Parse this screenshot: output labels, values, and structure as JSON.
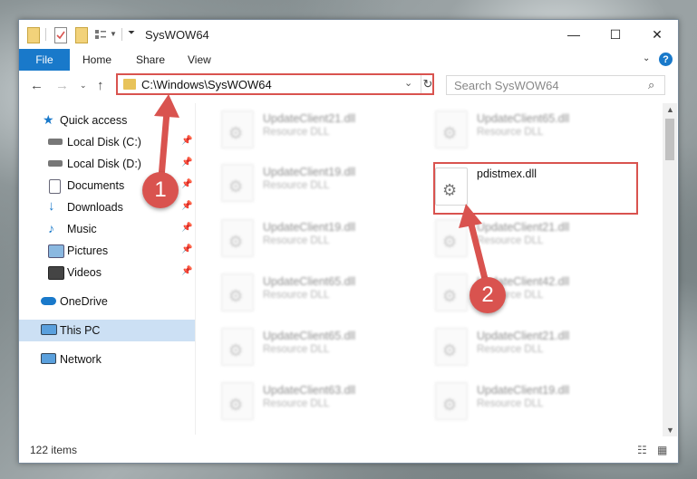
{
  "window": {
    "title": "SysWOW64",
    "minimize_glyph": "—",
    "maximize_glyph": "☐",
    "close_glyph": "✕"
  },
  "ribbon": {
    "tabs": [
      "File",
      "Home",
      "Share",
      "View"
    ],
    "help_glyph": "?"
  },
  "navbar": {
    "address": "C:\\Windows\\SysWOW64",
    "search_placeholder": "Search SysWOW64"
  },
  "nav_pane": {
    "items": [
      {
        "label": "Quick access",
        "icon": "star-icon",
        "pinned": false
      },
      {
        "label": "Local Disk (C:)",
        "icon": "drive-icon",
        "pinned": true
      },
      {
        "label": "Local Disk (D:)",
        "icon": "drive-icon",
        "pinned": true
      },
      {
        "label": "Documents",
        "icon": "document-icon",
        "pinned": true
      },
      {
        "label": "Downloads",
        "icon": "download-icon",
        "pinned": true
      },
      {
        "label": "Music",
        "icon": "music-icon",
        "pinned": true
      },
      {
        "label": "Pictures",
        "icon": "pictures-icon",
        "pinned": true
      },
      {
        "label": "Videos",
        "icon": "video-icon",
        "pinned": true
      },
      {
        "label": "OneDrive",
        "icon": "cloud-icon",
        "pinned": false
      },
      {
        "label": "This PC",
        "icon": "computer-icon",
        "pinned": false,
        "selected": true
      },
      {
        "label": "Network",
        "icon": "network-icon",
        "pinned": false
      }
    ]
  },
  "files": {
    "left_column": [
      {
        "name": "UpdateClient21.dll",
        "type": "Resource DLL"
      },
      {
        "name": "UpdateClient19.dll",
        "type": "Resource DLL"
      },
      {
        "name": "UpdateClient19.dll",
        "type": "Resource DLL"
      },
      {
        "name": "UpdateClient65.dll",
        "type": "Resource DLL"
      },
      {
        "name": "UpdateClient65.dll",
        "type": "Resource DLL"
      },
      {
        "name": "UpdateClient63.dll",
        "type": "Resource DLL"
      }
    ],
    "right_column": [
      {
        "name": "UpdateClient65.dll",
        "type": "Resource DLL"
      },
      {
        "name": "pdistmex.dll",
        "type": ""
      },
      {
        "name": "UpdateClient21.dll",
        "type": "Resource DLL"
      },
      {
        "name": "UpdateClient42.dll",
        "type": "Resource DLL"
      },
      {
        "name": "UpdateClient21.dll",
        "type": "Resource DLL"
      },
      {
        "name": "UpdateClient19.dll",
        "type": "Resource DLL"
      }
    ]
  },
  "status": {
    "item_count": "122 items"
  },
  "annotations": {
    "badge1": "1",
    "badge2": "2",
    "color": "#d9534f"
  }
}
